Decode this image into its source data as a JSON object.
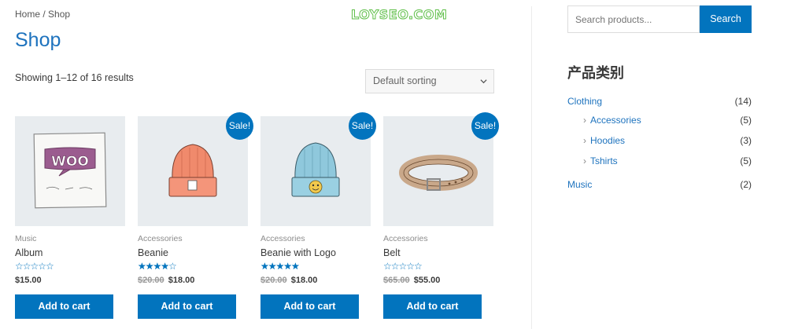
{
  "breadcrumb": {
    "home": "Home",
    "separator": " / ",
    "current": "Shop"
  },
  "watermark": "LOYSEO.COM",
  "page": {
    "title": "Shop",
    "result_count": "Showing 1–12 of 16 results"
  },
  "sorting": {
    "selected": "Default sorting",
    "icon": "chevron-down-icon"
  },
  "products": [
    {
      "category": "Music",
      "name": "Album",
      "rating": 0,
      "regular_price": "",
      "price": "$15.00",
      "sale": false,
      "button": "Add to cart"
    },
    {
      "category": "Accessories",
      "name": "Beanie",
      "rating": 4,
      "regular_price": "$20.00",
      "price": "$18.00",
      "sale": true,
      "sale_label": "Sale!",
      "button": "Add to cart"
    },
    {
      "category": "Accessories",
      "name": "Beanie with Logo",
      "rating": 5,
      "regular_price": "$20.00",
      "price": "$18.00",
      "sale": true,
      "sale_label": "Sale!",
      "button": "Add to cart"
    },
    {
      "category": "Accessories",
      "name": "Belt",
      "rating": 0,
      "regular_price": "$65.00",
      "price": "$55.00",
      "sale": true,
      "sale_label": "Sale!",
      "button": "Add to cart"
    }
  ],
  "sidebar": {
    "search": {
      "placeholder": "Search products...",
      "button": "Search"
    },
    "categories_title": "产品类别",
    "categories": [
      {
        "label": "Clothing",
        "count": "(14)",
        "child": false
      },
      {
        "label": "Accessories",
        "count": "(5)",
        "child": true
      },
      {
        "label": "Hoodies",
        "count": "(3)",
        "child": true
      },
      {
        "label": "Tshirts",
        "count": "(5)",
        "child": true
      },
      {
        "label": "Music",
        "count": "(2)",
        "child": false
      }
    ]
  },
  "colors": {
    "accent": "#0274be",
    "link": "#1e73be",
    "thumb_bg": "#e8ecef",
    "watermark": "#5fbf49"
  }
}
